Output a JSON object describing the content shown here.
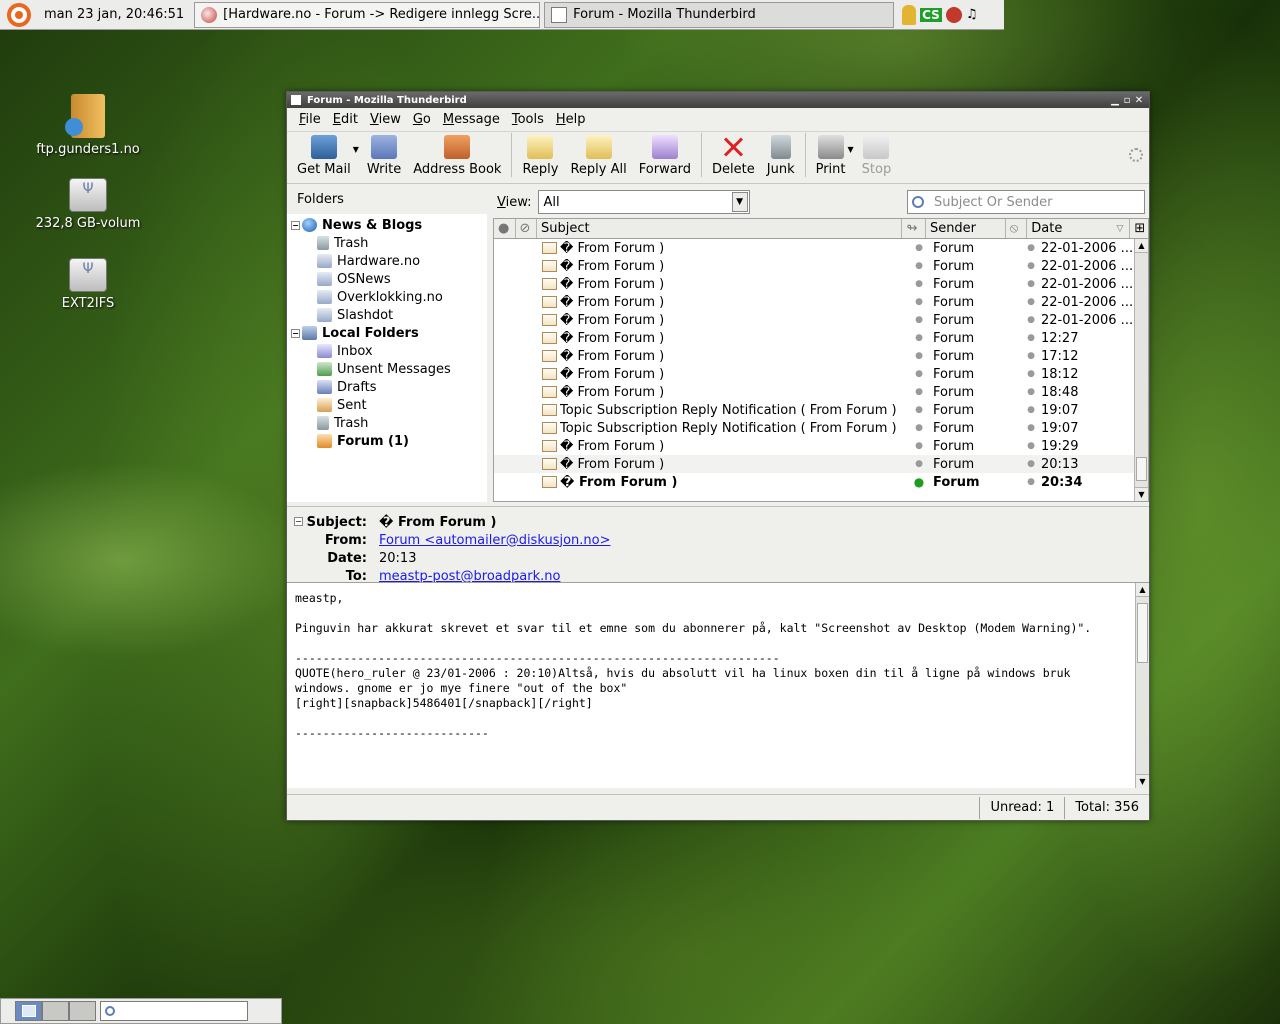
{
  "top_panel": {
    "clock": "man 23 jan, 20:46:51",
    "tasks": [
      {
        "label": "[Hardware.no - Forum -> Redigere innlegg Scre...",
        "icon": "firefox-icon"
      },
      {
        "label": "Forum - Mozilla Thunderbird",
        "icon": "thunderbird-icon"
      }
    ],
    "tray_cs": "CS",
    "tray_music": "♫"
  },
  "desktop_icons": [
    {
      "label": "ftp.gunders1.no",
      "icon": "ftp-folder-icon"
    },
    {
      "label": "232,8 GB-volum",
      "icon": "drive-icon"
    },
    {
      "label": "EXT2IFS",
      "icon": "drive-icon"
    }
  ],
  "window": {
    "title": "Forum - Mozilla Thunderbird",
    "menu": [
      "File",
      "Edit",
      "View",
      "Go",
      "Message",
      "Tools",
      "Help"
    ],
    "toolbar": {
      "get_mail": "Get Mail",
      "write": "Write",
      "address_book": "Address Book",
      "reply": "Reply",
      "reply_all": "Reply All",
      "forward": "Forward",
      "delete": "Delete",
      "junk": "Junk",
      "print": "Print",
      "stop": "Stop"
    }
  },
  "folders": {
    "header": "Folders",
    "tree": [
      {
        "label": "News & Blogs",
        "icon": "globe-icon",
        "level": 0,
        "bold": true,
        "expander": "−"
      },
      {
        "label": "Trash",
        "icon": "trash-icon",
        "level": 1
      },
      {
        "label": "Hardware.no",
        "icon": "rss-icon",
        "level": 1
      },
      {
        "label": "OSNews",
        "icon": "rss-icon",
        "level": 1
      },
      {
        "label": "Overklokking.no",
        "icon": "rss-icon",
        "level": 1
      },
      {
        "label": "Slashdot",
        "icon": "rss-icon",
        "level": 1
      },
      {
        "label": "Local Folders",
        "icon": "computer-icon",
        "level": 0,
        "bold": true,
        "expander": "−"
      },
      {
        "label": "Inbox",
        "icon": "inbox-icon",
        "level": 1
      },
      {
        "label": "Unsent Messages",
        "icon": "unsent-icon",
        "level": 1
      },
      {
        "label": "Drafts",
        "icon": "drafts-icon",
        "level": 1
      },
      {
        "label": "Sent",
        "icon": "sent-icon",
        "level": 1
      },
      {
        "label": "Trash",
        "icon": "trash-icon",
        "level": 1
      },
      {
        "label": "Forum (1)",
        "icon": "forum-folder-icon",
        "level": 1,
        "bold": true
      }
    ]
  },
  "view_bar": {
    "label": "View:",
    "selected": "All",
    "search_placeholder": "Subject Or Sender"
  },
  "thread_columns": {
    "subject": "Subject",
    "sender": "Sender",
    "date": "Date"
  },
  "messages": [
    {
      "subject": "� From Forum )",
      "sender": "Forum",
      "date": "22-01-2006 ..."
    },
    {
      "subject": "� From Forum )",
      "sender": "Forum",
      "date": "22-01-2006 ..."
    },
    {
      "subject": "� From Forum )",
      "sender": "Forum",
      "date": "22-01-2006 ..."
    },
    {
      "subject": "� From Forum )",
      "sender": "Forum",
      "date": "22-01-2006 ..."
    },
    {
      "subject": "� From Forum )",
      "sender": "Forum",
      "date": "22-01-2006 ..."
    },
    {
      "subject": "� From Forum )",
      "sender": "Forum",
      "date": "12:27"
    },
    {
      "subject": "� From Forum )",
      "sender": "Forum",
      "date": "17:12"
    },
    {
      "subject": "� From Forum )",
      "sender": "Forum",
      "date": "18:12"
    },
    {
      "subject": "� From Forum )",
      "sender": "Forum",
      "date": "18:48"
    },
    {
      "subject": "Topic Subscription Reply Notification ( From Forum )",
      "sender": "Forum",
      "date": "19:07"
    },
    {
      "subject": "Topic Subscription Reply Notification ( From Forum )",
      "sender": "Forum",
      "date": "19:07"
    },
    {
      "subject": "� From Forum )",
      "sender": "Forum",
      "date": "19:29"
    },
    {
      "subject": "� From Forum )",
      "sender": "Forum",
      "date": "20:13",
      "selected": true
    },
    {
      "subject": "� From Forum )",
      "sender": "Forum",
      "date": "20:34",
      "unread": true
    }
  ],
  "message_header": {
    "subject_label": "Subject:",
    "subject": "� From Forum )",
    "from_label": "From:",
    "from": "Forum <automailer@diskusjon.no>",
    "date_label": "Date:",
    "date": "20:13",
    "to_label": "To:",
    "to": "meastp-post@broadpark.no"
  },
  "message_body": "meastp,\n\nPinguvin har akkurat skrevet et svar til et emne som du abonnerer på, kalt \"Screenshot av Desktop (Modem Warning)\".\n\n----------------------------------------------------------------------\nQUOTE(hero_ruler @ 23/01-2006 : 20:10)Altså, hvis du absolutt vil ha linux boxen din til å ligne på windows bruk windows. gnome er jo mye finere \"out of the box\"\n[right][snapback]5486401[/snapback][/right]\n\n----------------------------\n\n\n\n",
  "status": {
    "unread": "Unread: 1",
    "total": "Total: 356"
  }
}
